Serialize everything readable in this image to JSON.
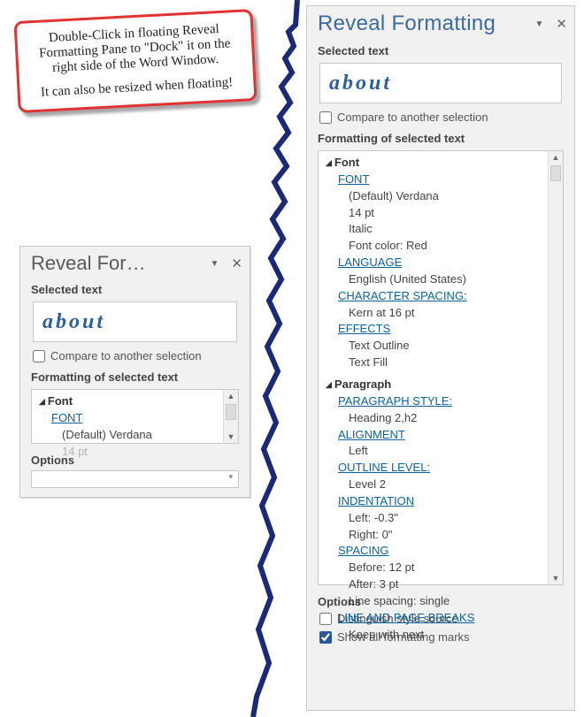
{
  "note": {
    "p1": "Double-Click in floating Reveal Formatting Pane to \"Dock\" it on the right side of the Word Window.",
    "p2": "It can also be resized when floating!"
  },
  "pane_float": {
    "title": "Reveal For…",
    "selected_text_heading": "Selected text",
    "selected_text_value": "about",
    "compare_label": "Compare to another selection",
    "formatting_heading": "Formatting of selected text",
    "options_heading": "Options",
    "font_group_label": "Font",
    "font_link_label": "FONT",
    "font_default": "(Default) Verdana",
    "font_size": "14 pt"
  },
  "pane_dock": {
    "title": "Reveal Formatting",
    "selected_text_heading": "Selected text",
    "selected_text_value": "about",
    "compare_label": "Compare to another selection",
    "formatting_heading": "Formatting of selected text",
    "options_heading": "Options",
    "distinguish_label": "Distinguish style source",
    "show_marks_label": "Show all formatting marks",
    "font": {
      "group": "Font",
      "link": "FONT",
      "default": "(Default) Verdana",
      "size": "14 pt",
      "italic": "Italic",
      "color": "Font color: Red",
      "language_link": "LANGUAGE",
      "language_val": "English (United States)",
      "charspacing_link": "CHARACTER SPACING:",
      "charspacing_val": "Kern at 16 pt",
      "effects_link": "EFFECTS",
      "effects_outline": "Text Outline",
      "effects_fill": "Text Fill"
    },
    "paragraph": {
      "group": "Paragraph",
      "style_link": "PARAGRAPH STYLE:",
      "style_val": "Heading 2,h2",
      "alignment_link": "ALIGNMENT",
      "alignment_val": "Left",
      "outline_link": "OUTLINE LEVEL:",
      "outline_val": "Level 2",
      "indent_link": "INDENTATION",
      "indent_left": "Left:  -0.3\"",
      "indent_right": "Right:  0\"",
      "spacing_link": "SPACING",
      "spacing_before": "Before:  12 pt",
      "spacing_after": "After:  3 pt",
      "spacing_line": "Line spacing:  single",
      "line_breaks_link": "LINE AND PAGE BREAKS",
      "keep_with_next": "Keep with next"
    }
  }
}
